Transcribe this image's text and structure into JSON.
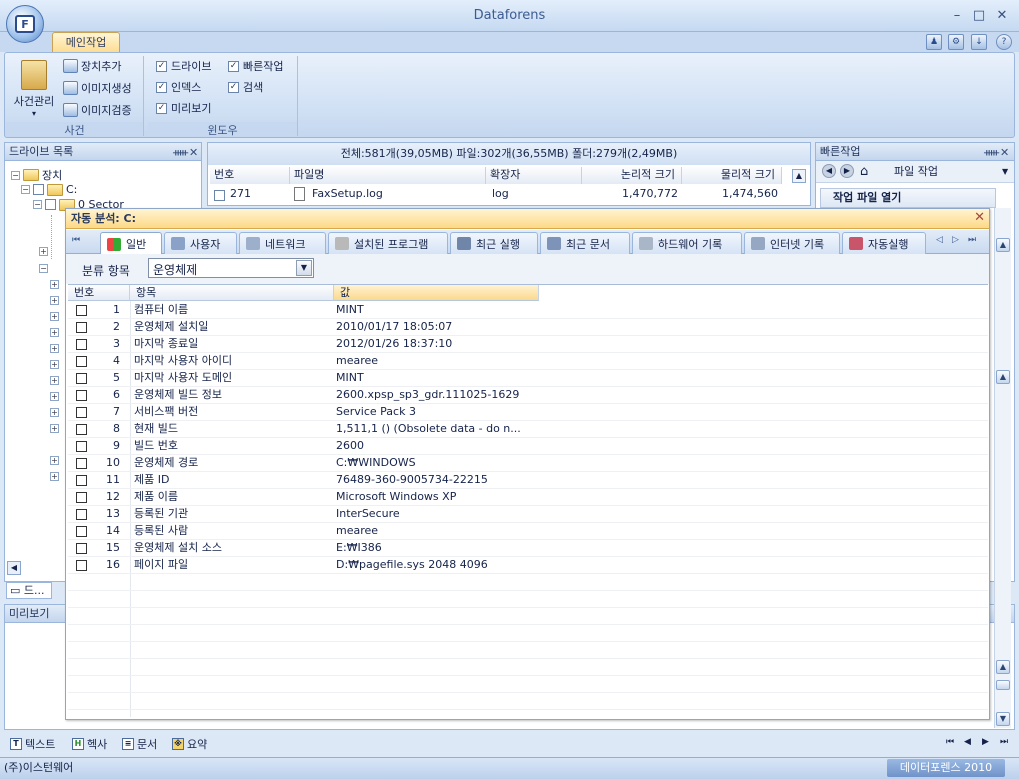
{
  "app": {
    "title": "Dataforens",
    "logo_letter": "F"
  },
  "window_controls": {
    "minimize": "–",
    "maximize": "□",
    "close": "✕"
  },
  "ribbon": {
    "tab": "메인작업",
    "case_group": {
      "label": "사건",
      "case_manage": "사건관리",
      "add_device": "장치추가",
      "create_image": "이미지생성",
      "verify_image": "이미지검증"
    },
    "window_group": {
      "label": "윈도우",
      "checks": [
        {
          "label": "드라이브",
          "checked": true
        },
        {
          "label": "빠른작업",
          "checked": true
        },
        {
          "label": "인덱스",
          "checked": true
        },
        {
          "label": "검색",
          "checked": true
        },
        {
          "label": "미리보기",
          "checked": true
        }
      ]
    }
  },
  "drive_panel": {
    "title": "드라이브 목록",
    "tree": {
      "root": "장치",
      "drive": "C:",
      "sector": "0 Sector"
    },
    "bottom_tab": "드..."
  },
  "file_list": {
    "stats": "전체:581개(39,05MB)    파일:302개(36,55MB)    폴더:279개(2,49MB)",
    "columns": [
      "번호",
      "파일명",
      "확장자",
      "논리적 크기",
      "물리적 크기"
    ],
    "row": {
      "no": "271",
      "name": "FaxSetup.log",
      "ext": "log",
      "logical": "1,470,772",
      "physical": "1,474,560"
    }
  },
  "quick_panel": {
    "title": "빠른작업",
    "toolbar_label": "파일 작업",
    "section": "작업 파일 열기"
  },
  "preview_panel": {
    "title": "미리보기"
  },
  "dialog": {
    "title": "자동 분석: C:",
    "tabs": [
      "일반",
      "사용자",
      "네트워크",
      "설치된 프로그램",
      "최근 실행",
      "최근 문서",
      "하드웨어 기록",
      "인터넷 기록",
      "자동실행"
    ],
    "category_label": "분류 항목",
    "category_value": "운영체제",
    "columns": [
      "번호",
      "항목",
      "값"
    ],
    "rows": [
      {
        "no": "1",
        "item": "컴퓨터 이름",
        "value": "MINT"
      },
      {
        "no": "2",
        "item": "운영체제 설치일",
        "value": "2010/01/17 18:05:07"
      },
      {
        "no": "3",
        "item": "마지막 종료일",
        "value": "2012/01/26 18:37:10"
      },
      {
        "no": "4",
        "item": "마지막 사용자 아이디",
        "value": "mearee"
      },
      {
        "no": "5",
        "item": "마지막 사용자 도메인",
        "value": "MINT"
      },
      {
        "no": "6",
        "item": "운영체제 빌드 정보",
        "value": "2600.xpsp_sp3_gdr.111025-1629"
      },
      {
        "no": "7",
        "item": "서비스팩 버전",
        "value": "Service Pack 3"
      },
      {
        "no": "8",
        "item": "현재 빌드",
        "value": "1,511,1 () (Obsolete data - do n..."
      },
      {
        "no": "9",
        "item": "빌드 번호",
        "value": "2600"
      },
      {
        "no": "10",
        "item": "운영체제 경로",
        "value": "C:₩WINDOWS"
      },
      {
        "no": "11",
        "item": "제품 ID",
        "value": "76489-360-9005734-22215"
      },
      {
        "no": "12",
        "item": "제품 이름",
        "value": "Microsoft Windows XP"
      },
      {
        "no": "13",
        "item": "등록된 기관",
        "value": "InterSecure"
      },
      {
        "no": "14",
        "item": "등록된 사람",
        "value": "mearee"
      },
      {
        "no": "15",
        "item": "운영체제 설치 소스",
        "value": "E:₩I386"
      },
      {
        "no": "16",
        "item": "페이지 파일",
        "value": "D:₩pagefile.sys 2048 4096"
      }
    ]
  },
  "bottom_tabs": [
    "텍스트",
    "헥사",
    "문서",
    "요약"
  ],
  "status": {
    "left": "(주)이스턴웨어",
    "right": "데이터포렌스 2010"
  },
  "colors": {
    "accent": "#fdd987",
    "frame": "#c6d9f1",
    "border": "#9ab6dd"
  }
}
